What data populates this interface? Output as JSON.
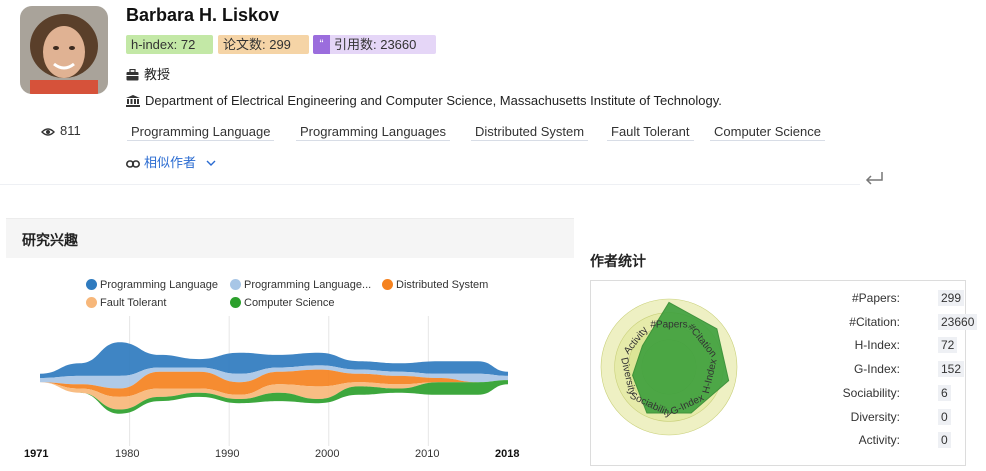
{
  "profile": {
    "name": "Barbara H. Liskov",
    "h_index_badge": "h-index: 72",
    "papers_badge": "论文数: 299",
    "citations_badge": "引用数: 23660",
    "citation_icon_glyph": "“",
    "title": "教授",
    "organization": "Department of Electrical Engineering and Computer Science, Massachusetts Institute of Technology.",
    "views": "811",
    "tags": [
      "Programming Language",
      "Programming Languages",
      "Distributed System",
      "Fault Tolerant",
      "Computer Science"
    ],
    "similar_authors": "相似作者"
  },
  "research_interests": {
    "title": "研究兴趣",
    "legend": [
      {
        "label": "Programming Language",
        "color": "#2f7bbf"
      },
      {
        "label": "Programming Language...",
        "color": "#a8c6e6"
      },
      {
        "label": "Distributed System",
        "color": "#f5821f"
      },
      {
        "label": "Fault Tolerant",
        "color": "#f7b77a"
      },
      {
        "label": "Computer Science",
        "color": "#2ca02c"
      }
    ],
    "axis_ticks": [
      "1971",
      "1980",
      "1990",
      "2000",
      "2010",
      "2018"
    ]
  },
  "chart_data": {
    "type": "area",
    "title": "",
    "x": [
      1971,
      1975,
      1979,
      1983,
      1987,
      1991,
      1995,
      1999,
      2003,
      2007,
      2011,
      2015,
      2018
    ],
    "series": [
      {
        "name": "Programming Language",
        "values": [
          1,
          3,
          8,
          3,
          2,
          5,
          3,
          3,
          2,
          2,
          3,
          3,
          1
        ]
      },
      {
        "name": "Programming Language...",
        "values": [
          1,
          2,
          3,
          1,
          1,
          2,
          1,
          1,
          1,
          1,
          1,
          2,
          1
        ]
      },
      {
        "name": "Distributed System",
        "values": [
          0,
          1,
          2,
          4,
          4,
          3,
          3,
          4,
          2,
          2,
          1,
          0,
          0
        ]
      },
      {
        "name": "Fault Tolerant",
        "values": [
          0,
          1,
          3,
          2,
          1,
          1,
          2,
          3,
          1,
          1,
          0,
          0,
          0
        ]
      },
      {
        "name": "Computer Science",
        "values": [
          0,
          0,
          1,
          1,
          1,
          1,
          2,
          1,
          2,
          1,
          3,
          3,
          1
        ]
      }
    ],
    "grid": true,
    "legend": "top"
  },
  "author_stats": {
    "title": "作者统计",
    "radar_axes": [
      "#Papers",
      "#Citation",
      "H-Index",
      "G-Index",
      "Sociability",
      "Diversity",
      "Activity"
    ],
    "radar_values": [
      0.95,
      0.9,
      0.9,
      0.75,
      0.75,
      0.55,
      0.5
    ],
    "rows": [
      {
        "label": "#Papers:",
        "value": "299"
      },
      {
        "label": "#Citation:",
        "value": "23660"
      },
      {
        "label": "H-Index:",
        "value": "72"
      },
      {
        "label": "G-Index:",
        "value": "152"
      },
      {
        "label": "Sociability:",
        "value": "6"
      },
      {
        "label": "Diversity:",
        "value": "0"
      },
      {
        "label": "Activity:",
        "value": "0"
      }
    ]
  },
  "colors": {
    "link": "#2a6bd1",
    "radar_fill": "#3da03d",
    "radar_ring": "#f0f2c8"
  }
}
